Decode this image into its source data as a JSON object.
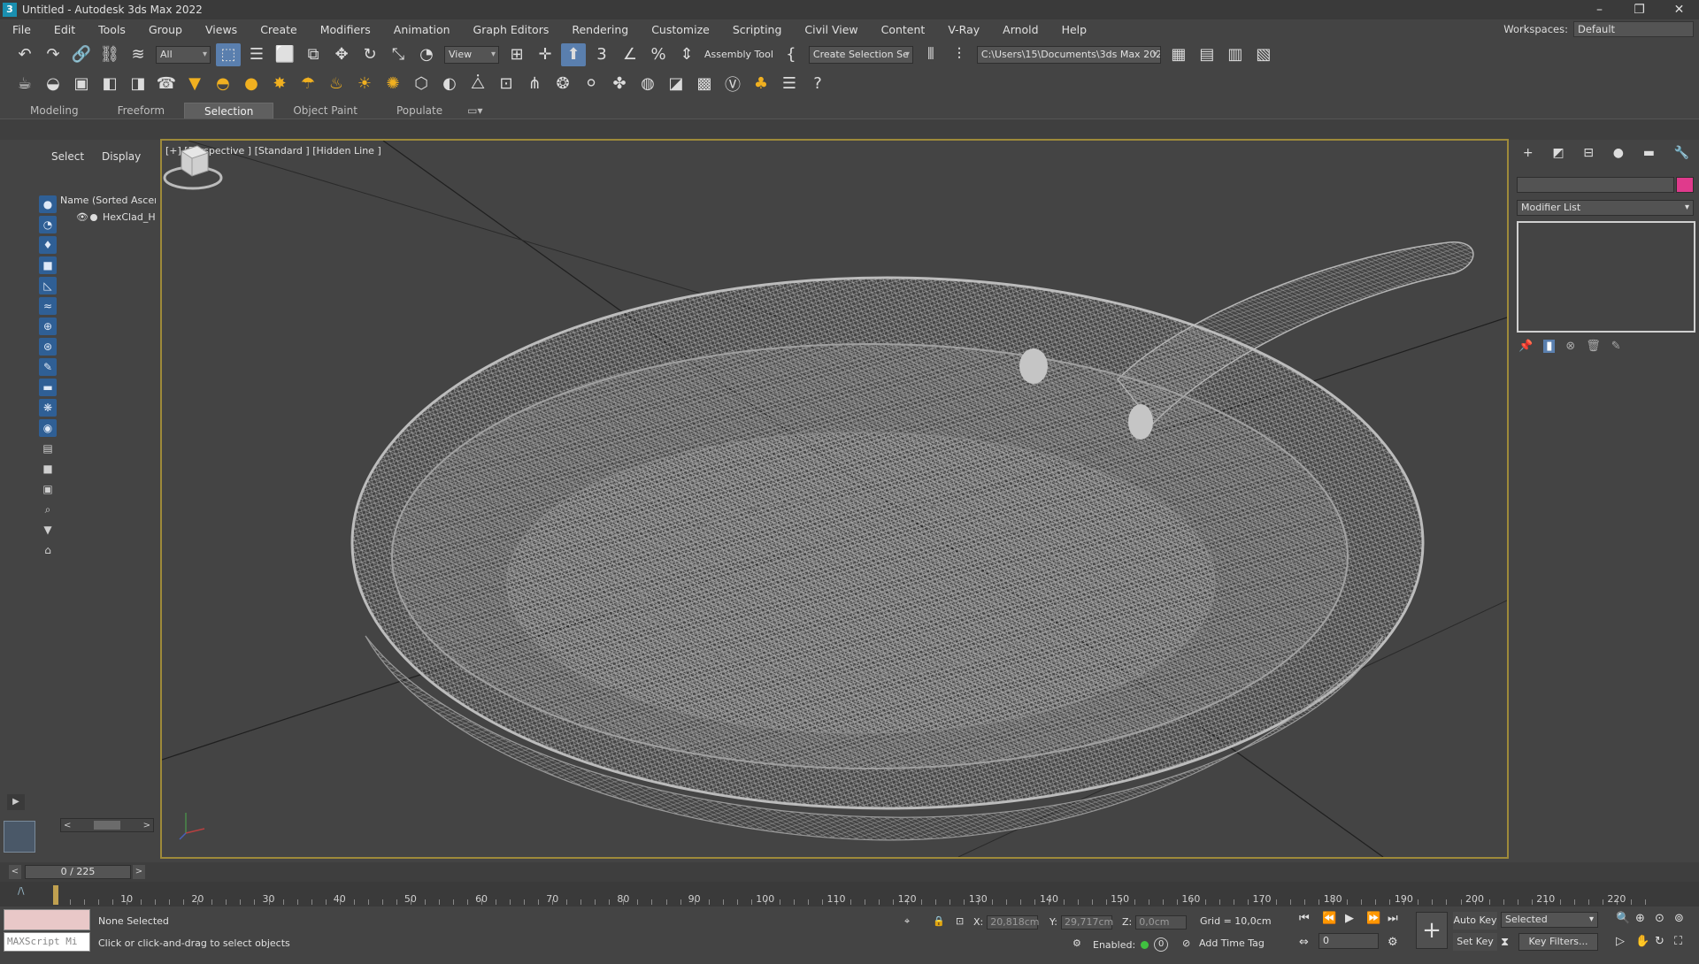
{
  "window": {
    "title": "Untitled - Autodesk 3ds Max 2022",
    "app_icon": "3",
    "controls": [
      "–",
      "❐",
      "✕"
    ]
  },
  "menu": [
    "File",
    "Edit",
    "Tools",
    "Group",
    "Views",
    "Create",
    "Modifiers",
    "Animation",
    "Graph Editors",
    "Rendering",
    "Customize",
    "Scripting",
    "Civil View",
    "Content",
    "V-Ray",
    "Arnold",
    "Help"
  ],
  "workspace": {
    "label": "Workspaces:",
    "value": "Default"
  },
  "toolbar": {
    "filter": "All",
    "ref_coord": "View",
    "assembly_tool": "Assembly Tool",
    "selection_set": "Create Selection Se",
    "project_path": "C:\\Users\\15\\Documents\\3ds Max 2022"
  },
  "ribbon": {
    "tabs": [
      "Modeling",
      "Freeform",
      "Selection",
      "Object Paint",
      "Populate"
    ],
    "active": "Selection"
  },
  "explorer": {
    "tabs": [
      "Select",
      "Display"
    ],
    "column_header": "Name (Sorted Ascend",
    "items": [
      {
        "name": "HexClad_H"
      }
    ]
  },
  "viewport": {
    "label": "[+] [Perspective ] [Standard ] [Hidden Line ]"
  },
  "command_panel": {
    "modifier_list": "Modifier List",
    "color_swatch": "#e03a8c"
  },
  "timeline": {
    "current": 0,
    "end": 225,
    "frame_label": "0 / 225",
    "ticks": [
      10,
      20,
      30,
      40,
      50,
      60,
      70,
      80,
      90,
      100,
      110,
      120,
      130,
      140,
      150,
      160,
      170,
      180,
      190,
      200,
      210,
      220
    ]
  },
  "status": {
    "maxscript_placeholder": "MAXScript Mi",
    "selection": "None Selected",
    "prompt": "Click or click-and-drag to select objects",
    "x_label": "X:",
    "x": "20,818cm",
    "y_label": "Y:",
    "y": "29,717cm",
    "z_label": "Z:",
    "z": "0,0cm",
    "grid": "Grid = 10,0cm",
    "enabled_label": "Enabled:",
    "enabled_value": "0",
    "add_time_tag": "Add Time Tag",
    "frame_field": "0",
    "auto_key": "Auto Key",
    "set_key": "Set Key",
    "key_mode": "Selected",
    "key_filters": "Key Filters..."
  }
}
